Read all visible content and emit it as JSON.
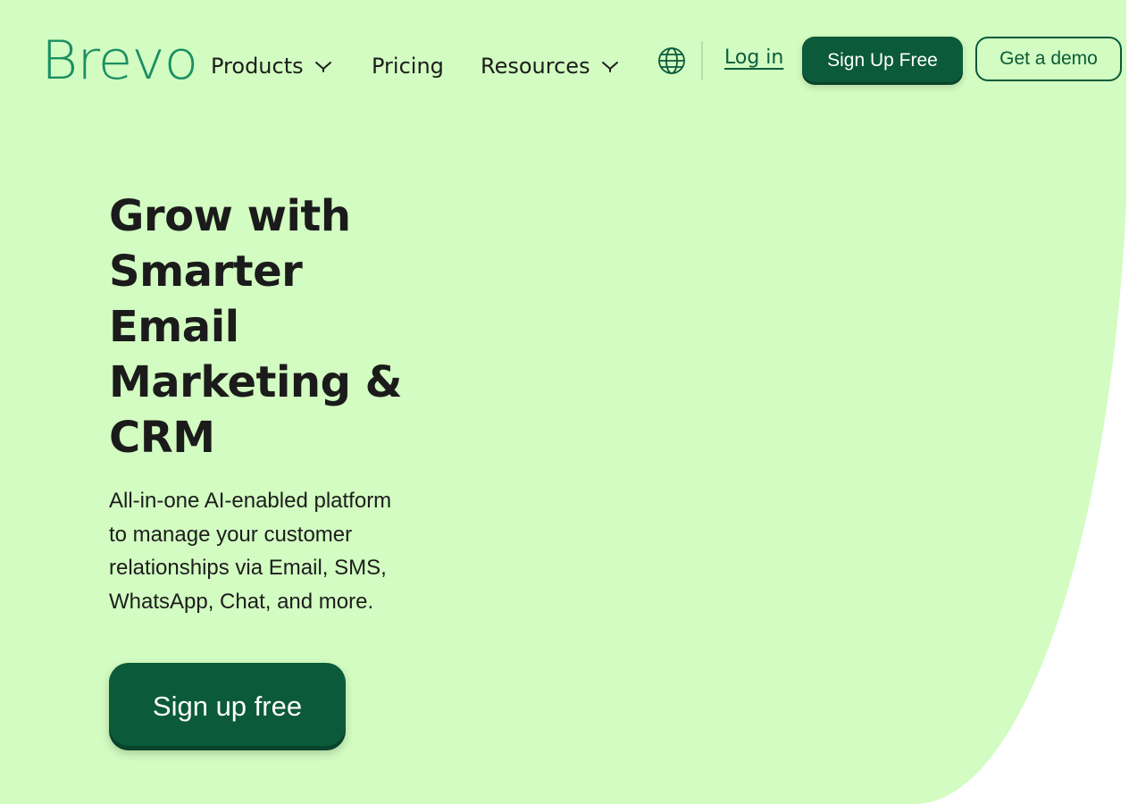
{
  "header": {
    "logo_text": "Brevo",
    "nav": {
      "products": "Products",
      "pricing": "Pricing",
      "resources": "Resources"
    },
    "language_icon": "globe-icon",
    "login": "Log in",
    "signup": "Sign Up Free",
    "demo": "Get a demo"
  },
  "hero": {
    "title_lines": [
      "Grow with",
      "Smarter",
      "Email",
      "Marketing &",
      "CRM"
    ],
    "subtitle_lines": [
      "All-in-one AI-enabled platform",
      "to manage your customer",
      "relationships via Email, SMS,",
      "WhatsApp, Chat, and more."
    ],
    "cta": "Sign up free"
  },
  "colors": {
    "background": "#d2fcc1",
    "brand_green": "#1b8f62",
    "button_dark_green": "#0b5a3a",
    "text_dark": "#1b1b1b"
  }
}
